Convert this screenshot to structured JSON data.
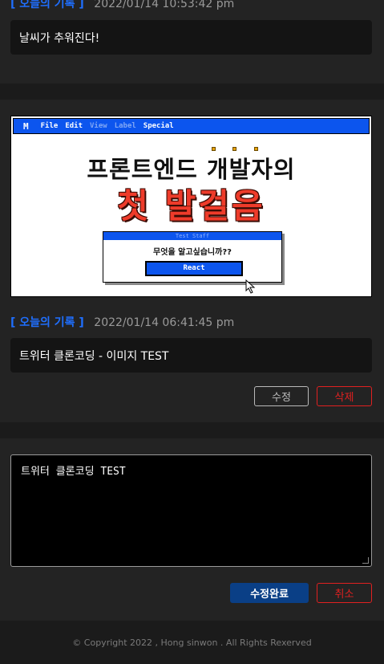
{
  "posts": [
    {
      "tag": "[ 오늘의 기록 ]",
      "timestamp": "2022/01/14 10:53:42 pm",
      "text": "날씨가 추워진다!"
    },
    {
      "tag": "[ 오늘의 기록 ]",
      "timestamp": "2022/01/14 06:41:45 pm",
      "text": "트위터 클론코딩 - 이미지 TEST",
      "edit_label": "수정",
      "delete_label": "삭제",
      "image": {
        "menu": [
          "File",
          "Edit",
          "View",
          "Label",
          "Special"
        ],
        "logo": "M",
        "title_line1": "프론트엔드 개발자의",
        "title_line2": "첫 발걸음",
        "dialog_title": "Test Staff",
        "dialog_question": "무엇을 알고싶습니까??",
        "dialog_button": "React"
      }
    }
  ],
  "editor": {
    "value": "트위터 클론코딩 TEST",
    "submit_label": "수정완료",
    "cancel_label": "취소"
  },
  "footer": {
    "text": "© Copyright 2022 , Hong sinwon . All Rights Rexerved"
  }
}
